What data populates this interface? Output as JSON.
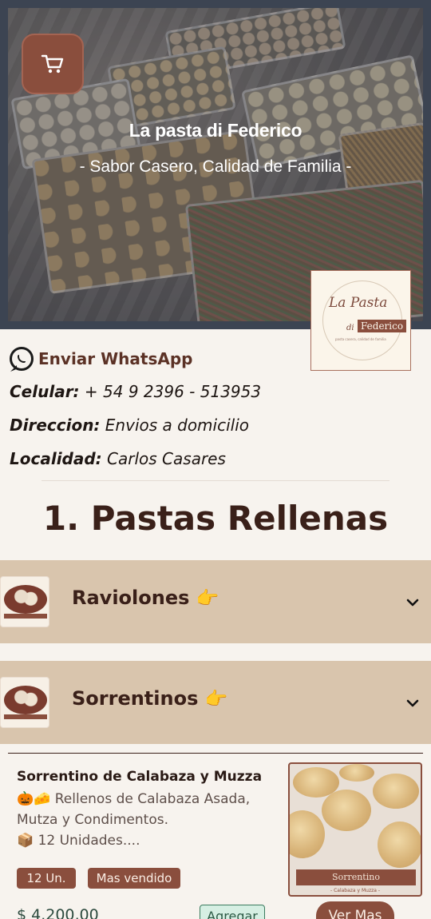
{
  "header": {
    "title": "La pasta di Federico",
    "subtitle": "- Sabor Casero, Calidad de Familia -",
    "logo": {
      "script": "La Pasta",
      "di": "di",
      "name": "Federico",
      "small": "pasta casera, calidad de familia"
    }
  },
  "contact": {
    "whatsapp_label": "Enviar WhatsApp",
    "phone_label": "Celular:",
    "phone_value": "+ 54 9 2396 - 513953",
    "address_label": "Direccion:",
    "address_value": "Envios a domicilio",
    "city_label": "Localidad:",
    "city_value": "Carlos Casares"
  },
  "section": {
    "title": "1. Pastas Rellenas"
  },
  "categories": [
    {
      "label": "Raviolones",
      "emoji": "👉",
      "expanded": false
    },
    {
      "label": "Sorrentinos",
      "emoji": "👉",
      "expanded": true
    }
  ],
  "product": {
    "name": "Sorrentino de Calabaza y Muzza",
    "desc_emoji": "🎃🧀",
    "desc_line1": "Rellenos de Calabaza Asada,",
    "desc_line2": "Mutza y Condimentos.",
    "units_emoji": "📦",
    "units_text": "12 Unidades....",
    "badges": [
      "12 Un.",
      "Mas vendido"
    ],
    "price": "$ 4.200,00",
    "add_label": "Agregar",
    "more_label": "Ver Mas",
    "image_label": "Sorrentino",
    "image_sublabel": "- Calabaza y Muzza -"
  },
  "colors": {
    "accent": "#8a4e3d",
    "category_bg": "#d9c5ad",
    "page_bg": "#f7f3ee",
    "price": "#2c4a3e",
    "add_button_bg": "#d6efe3"
  },
  "icons": {
    "cart": "cart-icon",
    "whatsapp": "whatsapp-icon",
    "chevron": "chevron-down-icon"
  }
}
